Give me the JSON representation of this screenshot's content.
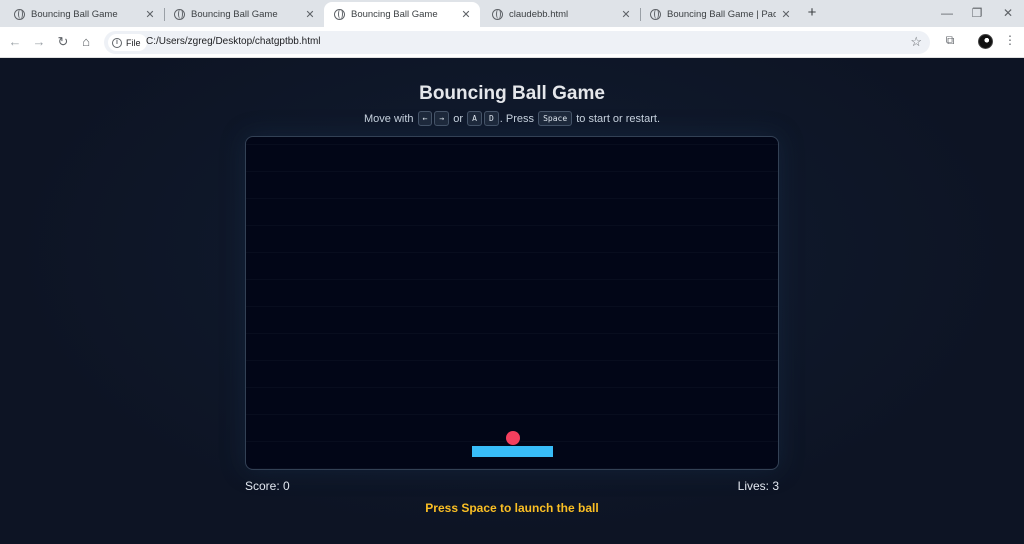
{
  "browser": {
    "tabs": [
      {
        "label": "Bouncing Ball Game",
        "active": false
      },
      {
        "label": "Bouncing Ball Game",
        "active": false
      },
      {
        "label": "Bouncing Ball Game",
        "active": true
      },
      {
        "label": "claudebb.html",
        "active": false
      },
      {
        "label": "Bouncing Ball Game | Paddle Bo",
        "active": false
      }
    ],
    "new_tab": "+",
    "window_controls": {
      "minimize": "—",
      "restore": "❐",
      "close": "✕"
    },
    "nav": {
      "back": "←",
      "forward": "→",
      "reload": "↻",
      "home": "⌂"
    },
    "site_chip": "File",
    "url": "C:/Users/zgreg/Desktop/chatgptbb.html",
    "icons": {
      "bookmark": "☆",
      "extensions": "⧉",
      "menu": "⋮"
    }
  },
  "game": {
    "title": "Bouncing Ball Game",
    "instructions": {
      "prefix": "Move with",
      "key_left": "←",
      "key_right": "→",
      "or": "or",
      "key_a": "A",
      "key_d": "D",
      "press": ". Press",
      "key_space": "Space",
      "suffix": "to start or restart."
    },
    "score_label": "Score: 0",
    "lives_label": "Lives: 3",
    "status": "Press Space to launch the ball",
    "colors": {
      "ball": "#f43f5e",
      "paddle": "#38bdf8",
      "status": "#fbbf24",
      "board": "#020617"
    }
  }
}
